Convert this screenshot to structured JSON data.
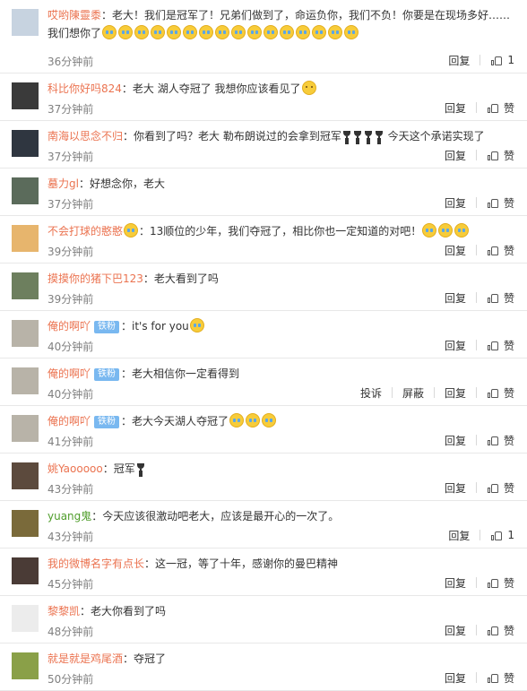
{
  "actions": {
    "reply": "回复",
    "report": "投诉",
    "block": "屏蔽"
  },
  "colors": {
    "username": "#eb7350",
    "username_green": "#4f9d2b",
    "badge": "#79b8f0",
    "time": "#808080"
  },
  "comments": [
    {
      "user": "哎哟陳靈黍",
      "avatar_icon": "default-avatar-icon",
      "avatar_color": "#c7d3e0",
      "text": "：老大！我们是冠军了！兄弟们做到了，命运负你，我们不负！你要是在现场多好……",
      "line2": "我们想你了",
      "emoji_count": 16,
      "emoji_type": "cry",
      "emoji_name": "cry-emoji-icon",
      "time": "36分钟前",
      "likes": "1"
    },
    {
      "user": "科比你好吗824",
      "avatar_icon": "kobe-avatar-icon",
      "avatar_color": "#3a3a3a",
      "text": "：老大 湖人夺冠了 我想你应该看见了",
      "emoji_count": 1,
      "emoji_type": "sad",
      "emoji_name": "sad-emoji-icon",
      "time": "37分钟前",
      "like_label": "赞"
    },
    {
      "user": "南海以思念不归",
      "avatar_icon": "player-avatar-icon",
      "avatar_color": "#2f3640",
      "text": "：你看到了吗？老大  勒布朗说过的会拿到冠军",
      "trophies": 4,
      "tail": " 今天这个承诺实现了",
      "time": "37分钟前",
      "like_label": "赞"
    },
    {
      "user": "墓力gl",
      "avatar_icon": "player-avatar-icon",
      "avatar_color": "#5b6b5b",
      "text": "：好想念你，老大",
      "time": "37分钟前",
      "like_label": "赞"
    },
    {
      "user": "不会打球的憨憨",
      "avatar_icon": "cartoon-avatar-icon",
      "avatar_color": "#e7b56d",
      "mid_emoji": true,
      "text": "：13顺位的少年，我们夺冠了，相比你也一定知道的对吧！",
      "emoji_count": 3,
      "emoji_type": "cry",
      "emoji_name": "cry-emoji-icon",
      "time": "39分钟前",
      "like_label": "赞"
    },
    {
      "user": "摸摸你的猪下巴123",
      "avatar_icon": "photo-avatar-icon",
      "avatar_color": "#6d7f5e",
      "text": "：老大看到了吗",
      "time": "39分钟前",
      "like_label": "赞"
    },
    {
      "user": "俺的啊吖",
      "avatar_icon": "landscape-avatar-icon",
      "avatar_color": "#b8b3a8",
      "badge": "铁粉",
      "text": "：it's for you",
      "emoji_count": 1,
      "emoji_type": "cry",
      "emoji_name": "cry-emoji-icon",
      "time": "40分钟前",
      "like_label": "赞"
    },
    {
      "user": "俺的啊吖",
      "avatar_icon": "landscape-avatar-icon",
      "avatar_color": "#b8b3a8",
      "badge": "铁粉",
      "text": "：老大相信你一定看得到",
      "time": "40分钟前",
      "show_report": true,
      "like_label": "赞"
    },
    {
      "user": "俺的啊吖",
      "avatar_icon": "landscape-avatar-icon",
      "avatar_color": "#b8b3a8",
      "badge": "铁粉",
      "text": "：老大今天湖人夺冠了",
      "emoji_count": 3,
      "emoji_type": "cry",
      "emoji_name": "cry-emoji-icon",
      "time": "41分钟前",
      "like_label": "赞"
    },
    {
      "user": "姚Yaooooo",
      "avatar_icon": "player-avatar-icon",
      "avatar_color": "#5c4a3d",
      "text": "：冠军",
      "trophies": 1,
      "time": "43分钟前",
      "like_label": "赞"
    },
    {
      "user": "yuang鬼",
      "avatar_icon": "player-avatar-icon",
      "avatar_color": "#7a6a3a",
      "text": "：今天应该很激动吧老大，应该是最开心的一次了。",
      "time": "43分钟前",
      "likes": "1"
    },
    {
      "user": "我的微博名字有点长",
      "avatar_icon": "player-avatar-icon",
      "avatar_color": "#4a3b36",
      "text": "：这一冠，等了十年，感谢你的曼巴精神",
      "time": "45分钟前",
      "like_label": "赞"
    },
    {
      "user": "黎黎凯",
      "avatar_icon": "sketch-avatar-icon",
      "avatar_color": "#ececec",
      "text": "：老大你看到了吗",
      "time": "48分钟前",
      "like_label": "赞"
    },
    {
      "user": "就是就是鸡尾酒",
      "avatar_icon": "food-avatar-icon",
      "avatar_color": "#8aa048",
      "text": "：夺冠了",
      "time": "50分钟前",
      "like_label": "赞"
    }
  ]
}
